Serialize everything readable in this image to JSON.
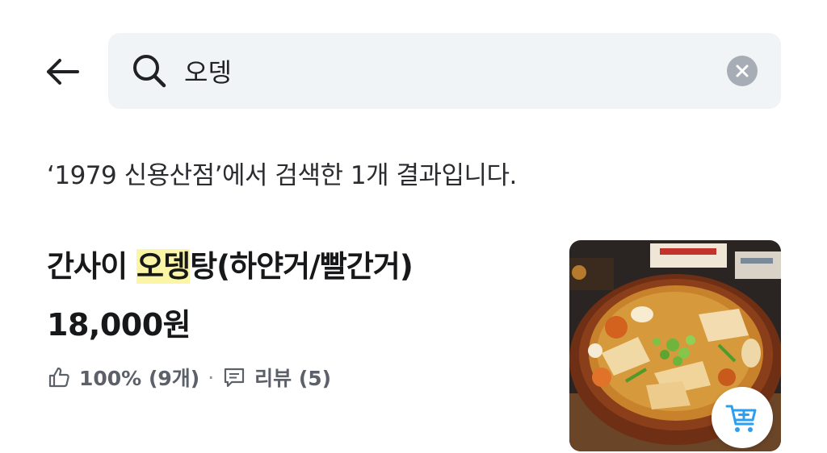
{
  "header": {
    "back_icon": "arrow-left-icon",
    "search": {
      "value": "오뎅",
      "icon": "search-icon",
      "clear_icon": "clear-circle-icon"
    }
  },
  "result_caption": "‘1979 신용산점’에서 검색한 1개 결과입니다.",
  "menu_item": {
    "name_prefix": "간사이 ",
    "name_highlight": "오뎅",
    "name_suffix": "탕(하얀거/빨간거)",
    "price": "18,000원",
    "rating": "100% (9개)",
    "separator": "·",
    "review_label": "리뷰 (5)",
    "rating_icon": "thumbs-up-icon",
    "review_icon": "comment-icon",
    "thumbnail": "oden-soup-photo",
    "cart_icon": "add-to-cart-icon"
  },
  "colors": {
    "search_bg": "#f1f4f6",
    "highlight": "#fbf6a6",
    "cart_icon": "#2b9ff0",
    "clear_btn": "#a7adb5"
  }
}
